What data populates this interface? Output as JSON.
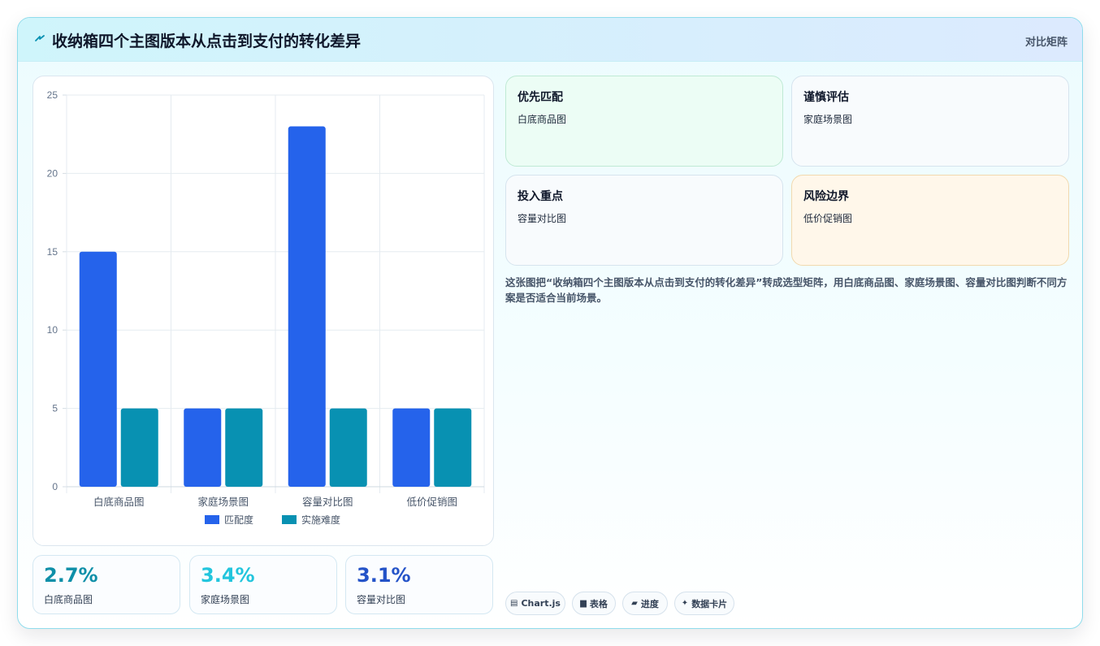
{
  "header": {
    "title": "收纳箱四个主图版本从点击到支付的转化差异",
    "right_label": "对比矩阵"
  },
  "colors": {
    "series1": "#2563eb",
    "series2": "#0891b2",
    "green_panel": "#ecfdf5",
    "amber_panel": "#fff7ea"
  },
  "chart_data": {
    "type": "bar",
    "categories": [
      "白底商品图",
      "家庭场景图",
      "容量对比图",
      "低价促销图"
    ],
    "series": [
      {
        "name": "匹配度",
        "values": [
          15,
          5,
          23,
          5
        ]
      },
      {
        "name": "实施难度",
        "values": [
          5,
          5,
          5,
          5
        ]
      }
    ],
    "ylim": [
      0,
      25
    ],
    "yticks": [
      0,
      5,
      10,
      15,
      20,
      25
    ],
    "grid": true,
    "legend": "bottom"
  },
  "kpis": [
    {
      "value": "2.7%",
      "label": "白底商品图",
      "color": "#0e8fa8"
    },
    {
      "value": "3.4%",
      "label": "家庭场景图",
      "color": "#22c5dd"
    },
    {
      "value": "3.1%",
      "label": "容量对比图",
      "color": "#2453c8"
    }
  ],
  "panels": [
    {
      "title": "优先匹配",
      "value": "白底商品图"
    },
    {
      "title": "谨慎评估",
      "value": "家庭场景图"
    },
    {
      "title": "投入重点",
      "value": "容量对比图"
    },
    {
      "title": "风险边界",
      "value": "低价促销图"
    }
  ],
  "description": "这张图把“收纳箱四个主图版本从点击到支付的转化差异”转成选型矩阵，用白底商品图、家庭场景图、容量对比图判断不同方案是否适合当前场景。",
  "chips": [
    {
      "icon": "chart-icon",
      "glyph": "▤",
      "label": "Chart.js"
    },
    {
      "icon": "table-icon",
      "glyph": "▆",
      "label": "表格"
    },
    {
      "icon": "progress-icon",
      "glyph": "▰",
      "label": "进度"
    },
    {
      "icon": "data-card-icon",
      "glyph": "✦",
      "label": "数据卡片"
    }
  ]
}
